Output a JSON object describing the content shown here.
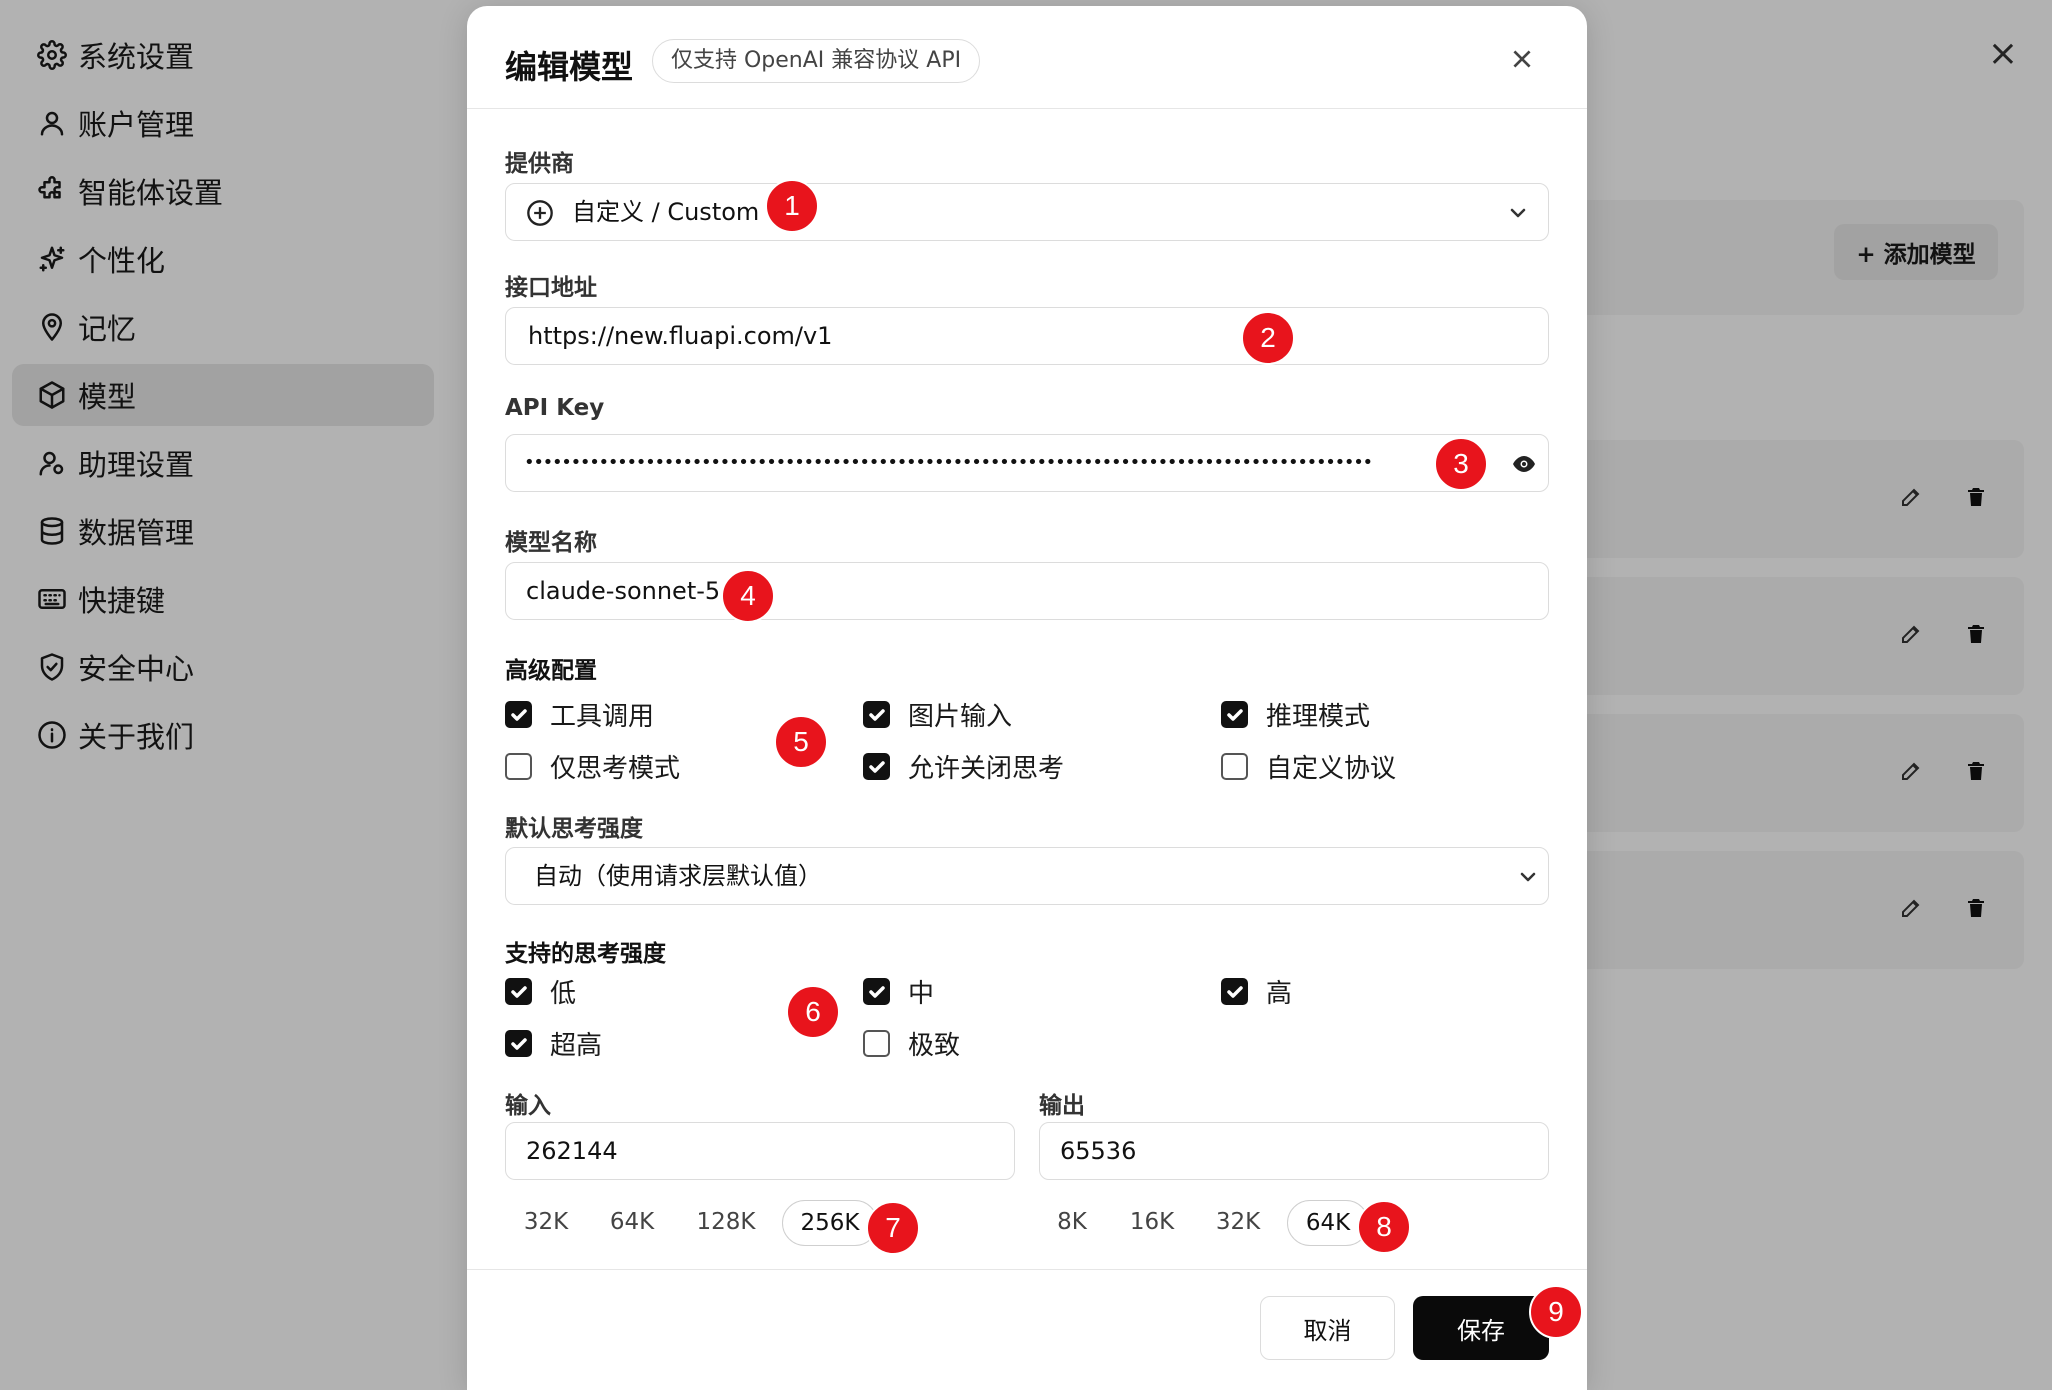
{
  "sidebar": {
    "items": [
      {
        "label": "系统设置",
        "icon": "gear-icon"
      },
      {
        "label": "账户管理",
        "icon": "user-icon"
      },
      {
        "label": "智能体设置",
        "icon": "puzzle-icon"
      },
      {
        "label": "个性化",
        "icon": "sparkle-icon"
      },
      {
        "label": "记忆",
        "icon": "memory-icon"
      },
      {
        "label": "模型",
        "icon": "cube-icon",
        "active": true
      },
      {
        "label": "助理设置",
        "icon": "user-gear-icon"
      },
      {
        "label": "数据管理",
        "icon": "database-icon"
      },
      {
        "label": "快捷键",
        "icon": "keyboard-icon"
      },
      {
        "label": "安全中心",
        "icon": "shield-icon"
      },
      {
        "label": "关于我们",
        "icon": "info-icon"
      }
    ]
  },
  "background": {
    "add_model_label": "+ 添加模型"
  },
  "modal": {
    "title": "编辑模型",
    "badge": "仅支持 OpenAI 兼容协议 API",
    "provider": {
      "label": "提供商",
      "value": "自定义 / Custom"
    },
    "endpoint": {
      "label": "接口地址",
      "value": "https://new.fluapi.com/v1"
    },
    "api_key": {
      "label": "API Key",
      "value": "•••••••••••••••••••••••••••••••••••••••••••••••••••••••••••••••••••••••••••••••••••••••••••"
    },
    "model_name": {
      "label": "模型名称",
      "value": "claude-sonnet-5"
    },
    "advanced": {
      "title": "高级配置",
      "options": [
        {
          "label": "工具调用",
          "checked": true
        },
        {
          "label": "图片输入",
          "checked": true
        },
        {
          "label": "推理模式",
          "checked": true
        },
        {
          "label": "仅思考模式",
          "checked": false
        },
        {
          "label": "允许关闭思考",
          "checked": true
        },
        {
          "label": "自定义协议",
          "checked": false
        }
      ]
    },
    "default_effort": {
      "label": "默认思考强度",
      "value": "自动（使用请求层默认值）"
    },
    "supported_effort": {
      "title": "支持的思考强度",
      "options": [
        {
          "label": "低",
          "checked": true
        },
        {
          "label": "中",
          "checked": true
        },
        {
          "label": "高",
          "checked": true
        },
        {
          "label": "超高",
          "checked": true
        },
        {
          "label": "极致",
          "checked": false
        }
      ]
    },
    "input_tokens": {
      "label": "输入",
      "value": "262144",
      "presets": [
        "32K",
        "64K",
        "128K",
        "256K"
      ],
      "selected": "256K"
    },
    "output_tokens": {
      "label": "输出",
      "value": "65536",
      "presets": [
        "8K",
        "16K",
        "32K",
        "64K"
      ],
      "selected": "64K"
    },
    "cancel_label": "取消",
    "save_label": "保存"
  },
  "markers": [
    "1",
    "2",
    "3",
    "4",
    "5",
    "6",
    "7",
    "8",
    "9"
  ],
  "colors": {
    "marker": "#e8141c",
    "primary_button": "#0a0a0a",
    "checkbox_on": "#111111"
  }
}
